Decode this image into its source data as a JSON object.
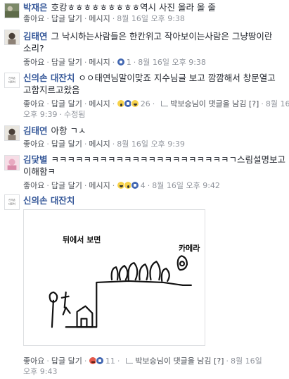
{
  "comments": [
    {
      "name": "박재은",
      "text": "호캉ㅎㅎㅎㅎㅎㅎㅎㅎㅎ역시 사진 올라 올 줄",
      "actions": {
        "like": "좋아요",
        "reply": "답글 달기",
        "message": "메시지",
        "time": "8월 16일 오후 9:38"
      }
    },
    {
      "name": "김태연",
      "text_line1": "그 낙시하는사람들은 한칸위고 작아보이는사람은 그냥땅이란",
      "text_line2": "소리?",
      "actions": {
        "like": "좋아요",
        "reply": "답글 달기",
        "message": "메시지",
        "reaction_count": "1",
        "time": "8월 16일 오후 9:38"
      }
    },
    {
      "name": "신의손 대잔치",
      "avatar_text": "신의손 대잔치",
      "text_line1": "ㅇㅇ태연님말이맞죠 지수님글 보고 깜깜해서 창문열고",
      "text_line2": "고함지르고왔음",
      "actions": {
        "like": "좋아요",
        "reply": "답글 달기",
        "message": "메시지",
        "reaction_count": "26",
        "replied_text": "박보승님이 댓글을 남김 [?]",
        "time_line1": "8월 16일",
        "time_line2": "오후 9:39",
        "edited": "수정됨"
      }
    },
    {
      "name": "김태연",
      "text": "아항 ㄱㅅ",
      "actions": {
        "like": "좋아요",
        "reply": "답글 달기",
        "message": "메시지",
        "time": "8월 16일 오후 9:39"
      }
    },
    {
      "name": "김닻별",
      "text_line1": "ㅋㅋㅋㅋㅋㅋㅋㅋㅋㅋㅋㅋㅋㅋㅋㅋㅋㅋㅋㅋㅋㅋㄱ스림설명보고",
      "text_line2": "이해함ㅋ",
      "actions": {
        "like": "좋아요",
        "reply": "답글 달기",
        "message": "메시지",
        "reaction_count": "4",
        "time": "8월 16일 오후 9:42"
      }
    },
    {
      "name": "신의손 대잔치",
      "avatar_text": "신의손 대잔치",
      "actions": {
        "like": "좋아요",
        "reply": "답글 달기",
        "reaction_count": "11",
        "replied_text": "박보승님이 댓글을 남김 [?]",
        "time_line1": "8월 16일",
        "time_line2": "오후 9:43"
      }
    }
  ],
  "drawing": {
    "title": "뒤에서 보면",
    "camera_label": "카메라"
  },
  "colors": {
    "name": "#365899",
    "meta": "#90949c",
    "text": "#1d2129"
  }
}
